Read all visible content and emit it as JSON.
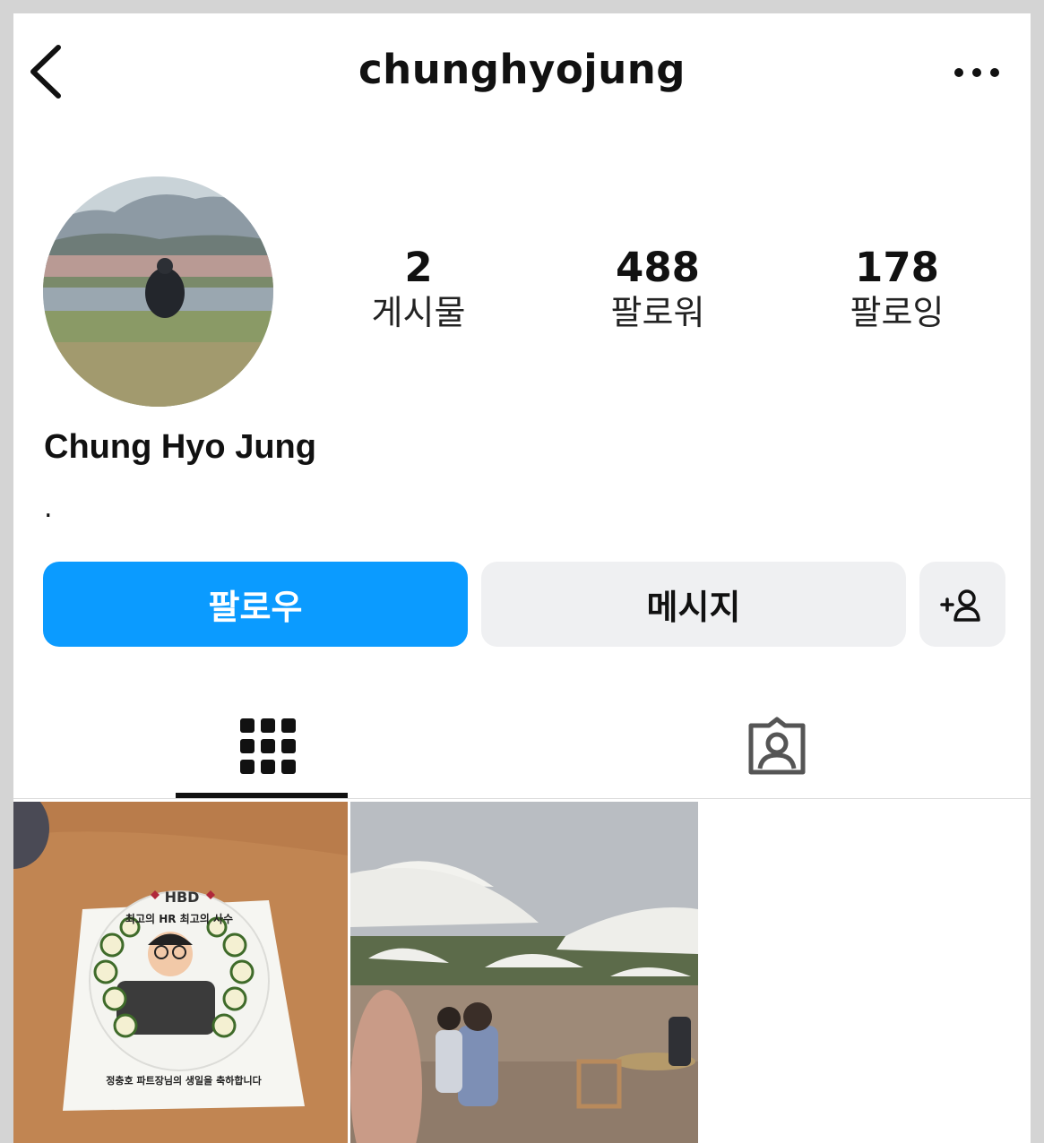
{
  "header": {
    "username": "chunghyojung",
    "back_icon": "chevron-left-icon",
    "more_icon": "ellipsis-icon"
  },
  "profile": {
    "name": "Chung Hyo Jung",
    "bio": ".",
    "stats": [
      {
        "value": "2",
        "label": "게시물"
      },
      {
        "value": "488",
        "label": "팔로워"
      },
      {
        "value": "178",
        "label": "팔로잉"
      }
    ]
  },
  "actions": {
    "follow_label": "팔로우",
    "message_label": "메시지",
    "add_person_icon": "add-person-icon",
    "follow_color": "#0b9bff"
  },
  "tabs": {
    "posts_icon": "grid-icon",
    "tagged_icon": "tagged-person-icon"
  },
  "posts": [
    {
      "image": "birthday cake photo",
      "cake_text": {
        "top": "HBD",
        "line1": "최고의 HR 최고의 사수",
        "line2": "정충호 파트장님의 생일을 축하합니다"
      }
    },
    {
      "image": "outdoor cafeteria with white umbrellas"
    }
  ]
}
